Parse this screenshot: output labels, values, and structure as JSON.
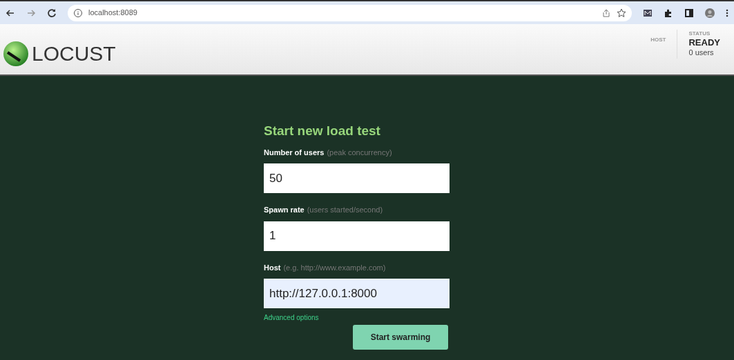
{
  "browser": {
    "url": "localhost:8089"
  },
  "header": {
    "logo": "LOCUST",
    "host_label": "HOST",
    "status_label": "STATUS",
    "status": "READY",
    "users": "0 users"
  },
  "form": {
    "title": "Start new load test",
    "fields": [
      {
        "label": "Number of users",
        "hint": "(peak concurrency)",
        "value": "50",
        "autofilled": false
      },
      {
        "label": "Spawn rate",
        "hint": "(users started/second)",
        "value": "1",
        "autofilled": false
      },
      {
        "label": "Host",
        "hint": "(e.g. http://www.example.com)",
        "value": "http://127.0.0.1:8000",
        "autofilled": true
      }
    ],
    "advanced_link": "Advanced options",
    "submit": "Start swarming"
  }
}
